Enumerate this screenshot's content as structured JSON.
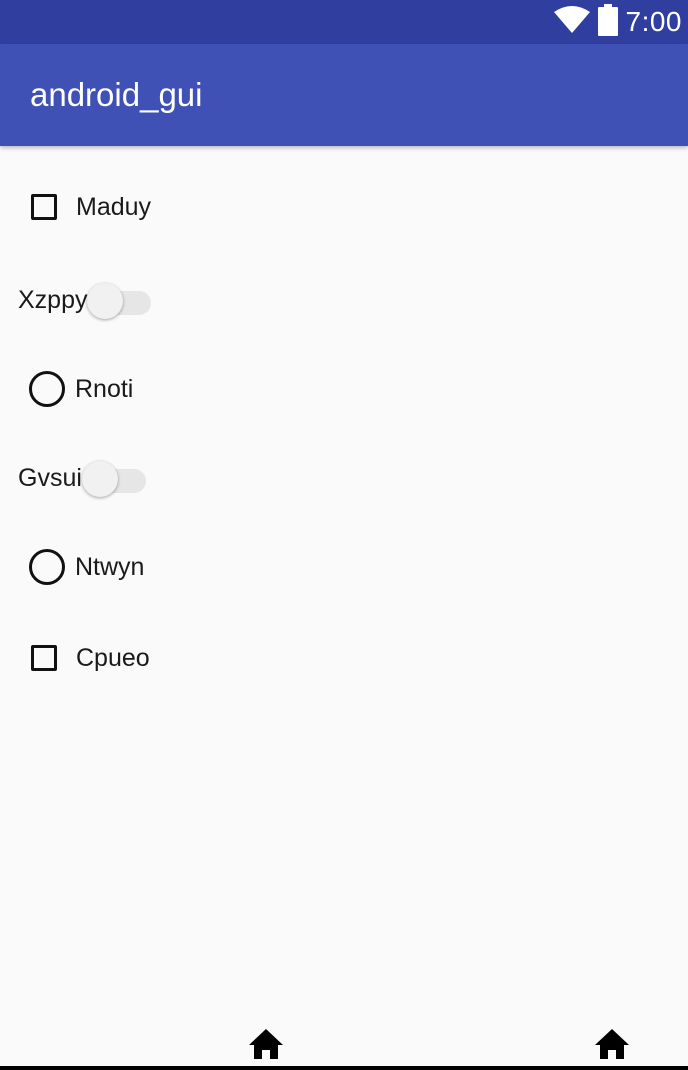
{
  "status_bar": {
    "time": "7:00",
    "icons": [
      "wifi-icon",
      "battery-icon"
    ],
    "color": "#303f9f"
  },
  "app_bar": {
    "title": "android_gui",
    "color": "#3f51b5"
  },
  "controls": [
    {
      "type": "checkbox",
      "label": "Maduy",
      "checked": false
    },
    {
      "type": "switch",
      "label": "Xzppy",
      "on": false
    },
    {
      "type": "radio",
      "label": "Rnoti",
      "selected": false
    },
    {
      "type": "switch",
      "label": "Gvsui",
      "on": false
    },
    {
      "type": "radio",
      "label": "Ntwyn",
      "selected": false
    },
    {
      "type": "checkbox",
      "label": "Cpueo",
      "checked": false
    }
  ],
  "nav_bar": {
    "buttons": [
      "home-icon",
      "home-icon"
    ]
  }
}
